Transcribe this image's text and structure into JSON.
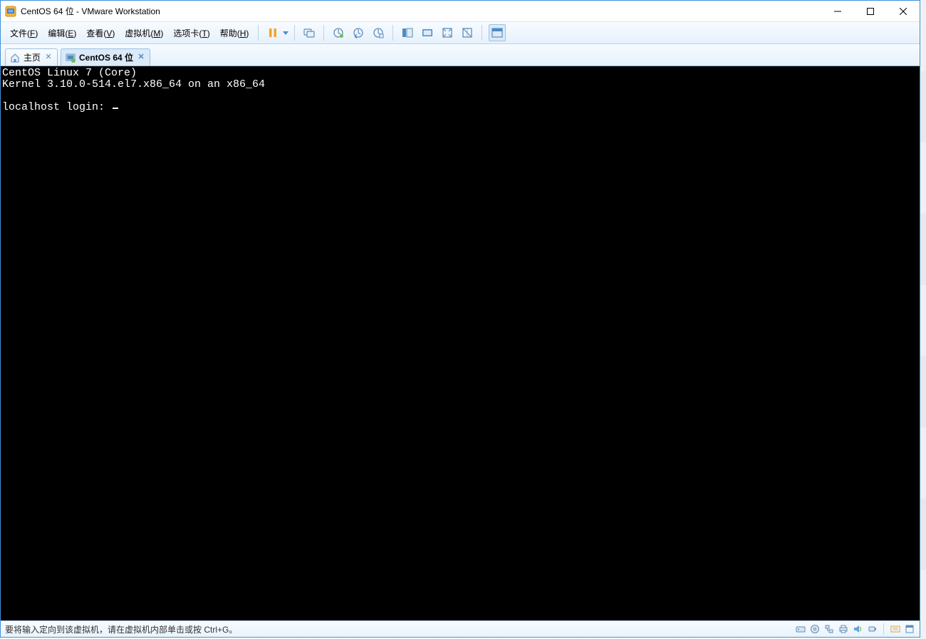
{
  "window": {
    "title": "CentOS 64 位 - VMware Workstation"
  },
  "menu": {
    "items": [
      {
        "label_pre": "文件(",
        "key": "F",
        "label_post": ")"
      },
      {
        "label_pre": "编辑(",
        "key": "E",
        "label_post": ")"
      },
      {
        "label_pre": "查看(",
        "key": "V",
        "label_post": ")"
      },
      {
        "label_pre": "虚拟机(",
        "key": "M",
        "label_post": ")"
      },
      {
        "label_pre": "选项卡(",
        "key": "T",
        "label_post": ")"
      },
      {
        "label_pre": "帮助(",
        "key": "H",
        "label_post": ")"
      }
    ]
  },
  "tabs": [
    {
      "label": "主页",
      "icon": "home",
      "active": false
    },
    {
      "label": "CentOS 64 位",
      "icon": "vm",
      "active": true
    }
  ],
  "console": {
    "line1": "CentOS Linux 7 (Core)",
    "line2": "Kernel 3.10.0-514.el7.x86_64 on an x86_64",
    "blank": "",
    "prompt": "localhost login: "
  },
  "statusbar": {
    "hint": "要将输入定向到该虚拟机，请在虚拟机内部单击或按 Ctrl+G。"
  }
}
